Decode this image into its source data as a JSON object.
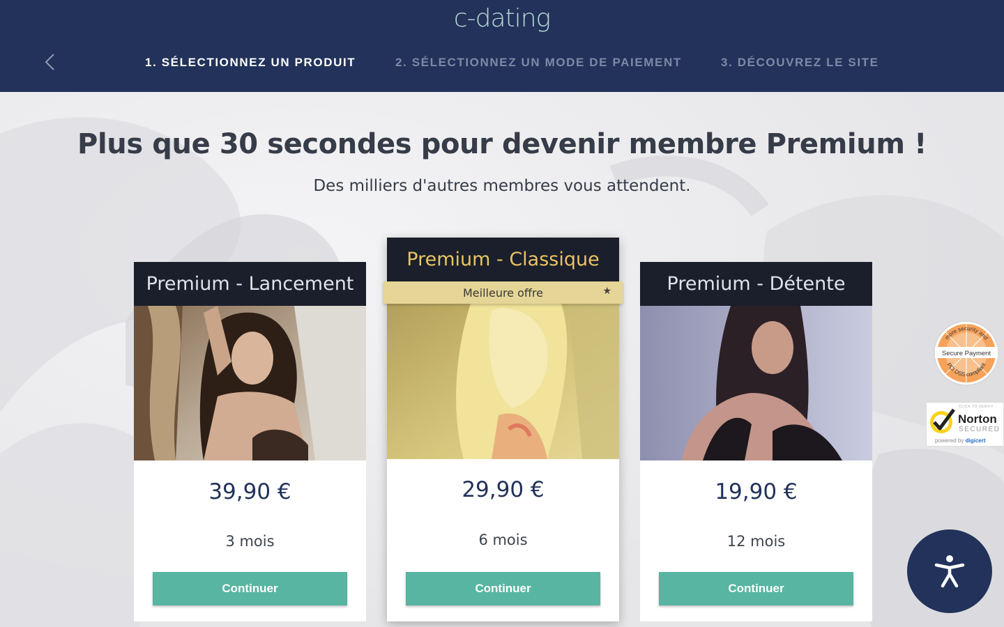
{
  "header": {
    "logo": "c-dating",
    "steps": [
      {
        "label": "1. SÉLECTIONNEZ UN PRODUIT",
        "active": true
      },
      {
        "label": "2. SÉLECTIONNEZ UN MODE DE PAIEMENT",
        "active": false
      },
      {
        "label": "3. DÉCOUVREZ LE SITE",
        "active": false
      }
    ],
    "back_icon": "chevron-left-icon"
  },
  "hero": {
    "title": "Plus que 30 secondes pour devenir membre Premium !",
    "subtitle": "Des milliers d'autres membres vous attendent."
  },
  "plans": [
    {
      "name": "Premium - Lancement",
      "price": "39,90 €",
      "duration": "3 mois",
      "cta": "Continuer"
    },
    {
      "name": "Premium - Classique",
      "badge": "Meilleure offre",
      "price": "29,90 €",
      "duration": "6 mois",
      "cta": "Continuer"
    },
    {
      "name": "Premium - Détente",
      "price": "19,90 €",
      "duration": "12 mois",
      "cta": "Continuer"
    }
  ],
  "trust": {
    "secure_payment": {
      "top": "more security and",
      "middle": "Secure Payment",
      "bottom": "PCI DSS compliant"
    },
    "norton": {
      "top": "CLICK TO VERIFY",
      "title": "Norton",
      "sub": "SECURED",
      "powered_prefix": "powered by",
      "powered_brand": "digicert"
    }
  },
  "accessibility_icon": "accessibility-icon",
  "colors": {
    "header_bg": "#22325a",
    "card_head_bg": "#1b1f2b",
    "accent_gold": "#e8c463",
    "button": "#58b5a1",
    "price": "#22325a"
  }
}
